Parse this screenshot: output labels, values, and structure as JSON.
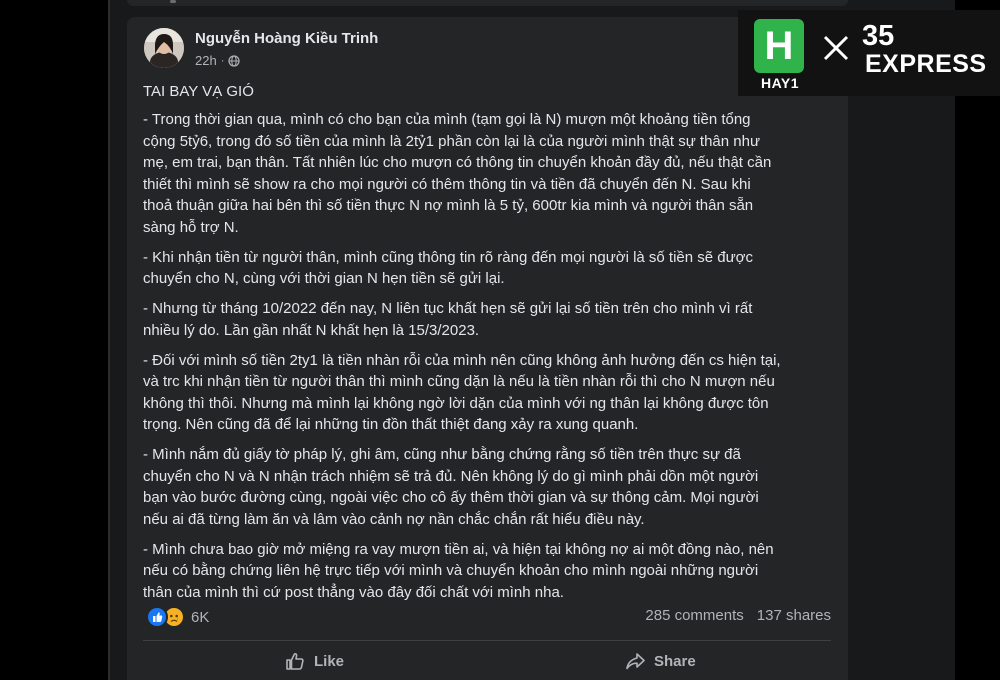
{
  "post": {
    "author": "Nguyễn Hoàng Kiều Trinh",
    "time": "22h",
    "separator": "·",
    "title": "TAI BAY VẠ GIÓ",
    "body_lines": [
      [
        "- Trong thời gian qua, mình có cho bạn của mình (tạm gọi là N) mượn một khoảng tiền tổng",
        "cộng 5tỷ6, trong đó số tiền của mình là 2tỷ1 phần còn lại là của người mình thật sự thân như",
        "mẹ, em trai, bạn thân. Tất nhiên lúc cho mượn có thông tin chuyển khoản đầy đủ, nếu thật cần",
        "thiết thì mình sẽ show ra cho mọi người có thêm thông tin và tiền đã chuyển đến N. Sau khi",
        "thoả thuận giữa hai bên thì số tiền thực N nợ mình là 5 tỷ, 600tr kia mình và người thân sẵn",
        "sàng hỗ trợ N."
      ],
      [
        "- Khi nhận tiền từ người thân, mình cũng thông tin rõ ràng đến mọi người là số tiền sẽ được",
        "chuyển cho N, cùng với thời gian N hẹn tiền sẽ gửi lại."
      ],
      [
        "- Nhưng từ tháng 10/2022 đến nay, N liên tục  khất hẹn sẽ gửi lại số tiền trên cho mình vì rất",
        "nhiều lý do. Lần gần nhất N khất hẹn là 15/3/2023."
      ],
      [
        "- Đối với mình số tiền 2ty1 là tiền nhàn rỗi của mình nên cũng không ảnh hưởng đến cs hiện tại,",
        "và trc khi nhận tiền từ người thân thì mình cũng dặn là nếu là tiền nhàn rỗi thì cho N mượn nếu",
        "không thì thôi. Nhưng mà mình lại không ngờ lời dặn của mình với ng thân lại không được tôn",
        "trọng. Nên cũng đã để lại những tin đồn thất thiệt đang xảy ra xung quanh."
      ],
      [
        "- Mình nắm đủ giấy tờ pháp lý, ghi âm, cũng như bằng chứng rằng số tiền trên thực sự đã",
        "chuyển cho N và N nhận trách nhiệm sẽ trả đủ. Nên không lý do gì mình phải dồn một người",
        "bạn vào bước đường cùng, ngoài việc cho cô ấy thêm thời gian và sự thông cảm. Mọi người",
        "nếu ai đã từng làm ăn và lâm vào cảnh nợ nần chắc chắn rất hiểu điều này."
      ],
      [
        "- Mình chưa bao giờ mở miệng ra vay mượn tiền ai, và hiện tại không nợ ai một đồng nào, nên",
        "nếu có bằng chứng liên hệ trực tiếp với mình và chuyển khoản cho mình ngoài những người",
        "thân của mình thì cứ post thẳng vào đây đối chất với mình nha."
      ]
    ],
    "reaction_count": "6K",
    "comments": "285 comments",
    "shares": "137 shares",
    "like_label": "Like",
    "share_label": "Share"
  },
  "watermark": {
    "hay_letter": "H",
    "hay_label": "HAY1",
    "brand_number": "35",
    "brand_word": "EXPRESS"
  },
  "colors": {
    "background": "#18191a",
    "card": "#242526",
    "text_primary": "#e4e6eb",
    "text_secondary": "#b0b3b8",
    "like_blue": "#1877f2",
    "sad_yellow": "#f7b125",
    "hay_green": "#2fb34a"
  },
  "icons": [
    "globe-icon",
    "like-reaction-icon",
    "sad-reaction-icon",
    "thumbs-up-icon",
    "share-arrow-icon",
    "close-x-icon"
  ]
}
